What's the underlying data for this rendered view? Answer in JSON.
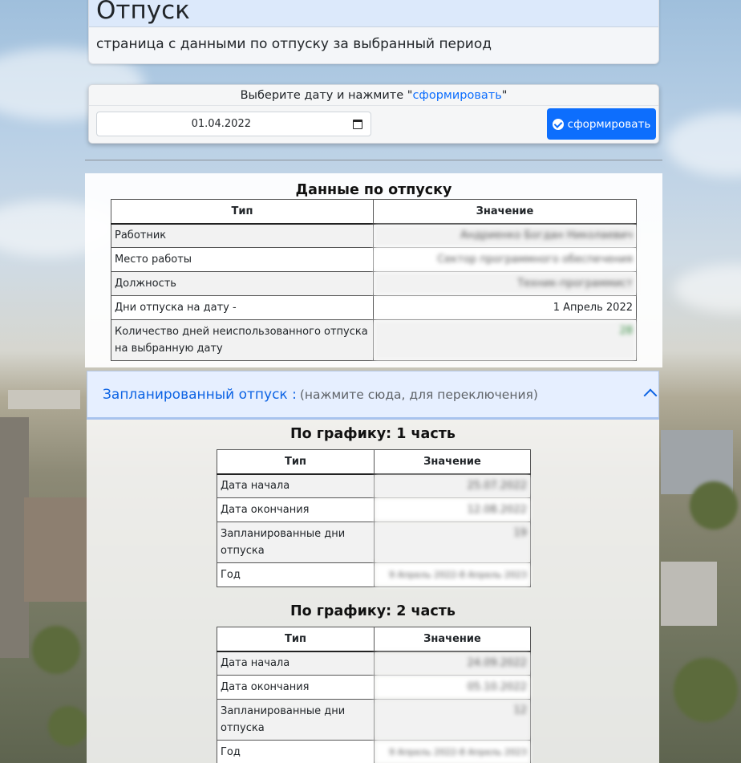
{
  "header": {
    "title": "Отпуск",
    "subtitle": "страница с данными по отпуску за выбранный период"
  },
  "form": {
    "hint_prefix": "Выберите дату и нажмите \"",
    "hint_link": "сформировать",
    "hint_suffix": "\"",
    "date_value": "01.04.2022",
    "submit_label": "сформировать",
    "submit_icon": "check-circle-icon"
  },
  "data_section": {
    "title": "Данные по отпуску",
    "columns": [
      "Тип",
      "Значение"
    ],
    "rows": [
      {
        "type": "Работник",
        "value": "Андриенко Богдан Николаевич"
      },
      {
        "type": "Место работы",
        "value": "Сектор программного обеспечения"
      },
      {
        "type": "Должность",
        "value": "Техник-программист"
      },
      {
        "type": "Дни отпуска на дату -",
        "value": "1 Апрель 2022"
      },
      {
        "type": "Количество дней неиспользованного отпуска на выбранную дату",
        "value": "28"
      }
    ]
  },
  "accordion": {
    "title": "Запланированный отпуск :",
    "note": "(нажмите сюда, для переключения)",
    "icon": "chevron-up-icon"
  },
  "schedules": [
    {
      "title": "По графику: 1 часть",
      "columns": [
        "Тип",
        "Значение"
      ],
      "rows": [
        {
          "type": "Дата начала",
          "value": "25.07.2022"
        },
        {
          "type": "Дата окончания",
          "value": "12.08.2022"
        },
        {
          "type": "Запланированные дни отпуска",
          "value": "19"
        },
        {
          "type": "Год",
          "value": "9 Апрель 2022-8 Апрель 2023"
        }
      ]
    },
    {
      "title": "По графику: 2 часть",
      "columns": [
        "Тип",
        "Значение"
      ],
      "rows": [
        {
          "type": "Дата начала",
          "value": "24.09.2022"
        },
        {
          "type": "Дата окончания",
          "value": "05.10.2022"
        },
        {
          "type": "Запланированные дни отпуска",
          "value": "12"
        },
        {
          "type": "Год",
          "value": "9 Апрель 2022-8 Апрель 2023"
        }
      ]
    }
  ]
}
